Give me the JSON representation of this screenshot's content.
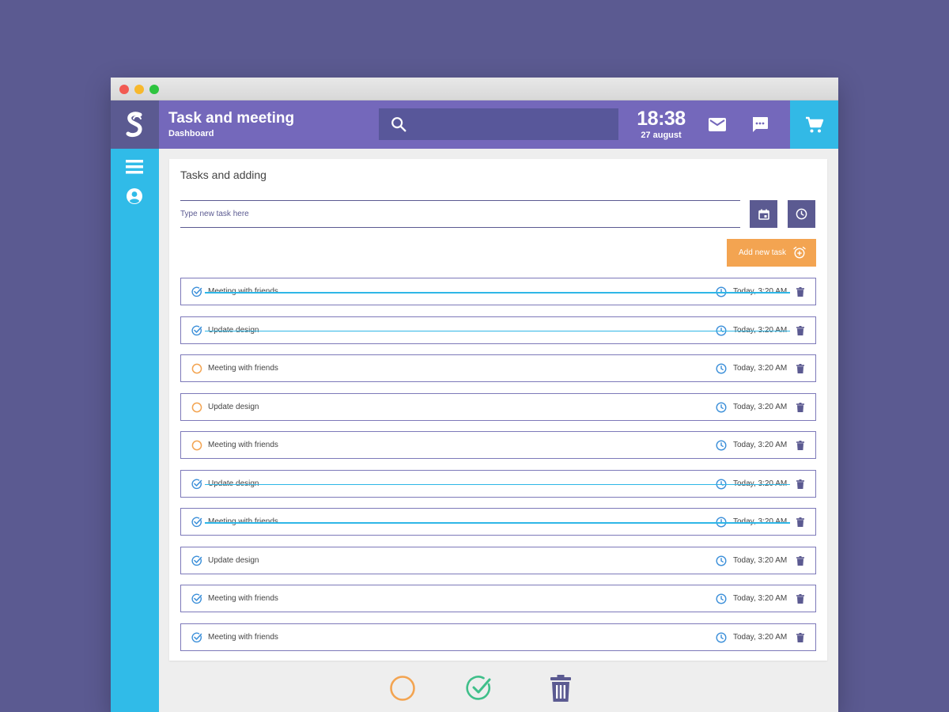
{
  "app": {
    "title": "Task and meeting",
    "subtitle": "Dashboard",
    "logo_letter": "S"
  },
  "header": {
    "time": "18:38",
    "date": "27 august",
    "search_placeholder": ""
  },
  "card": {
    "title": "Tasks and adding",
    "input_placeholder": "Type new task here",
    "add_button_label": "Add new task"
  },
  "tasks": [
    {
      "label": "Meeting with friends",
      "time": "Today, 3:20 AM",
      "state": "done-struck"
    },
    {
      "label": "Update design",
      "time": "Today, 3:20 AM",
      "state": "done-struck"
    },
    {
      "label": "Meeting with friends",
      "time": "Today, 3:20 AM",
      "state": "pending"
    },
    {
      "label": "Update design",
      "time": "Today, 3:20 AM",
      "state": "pending"
    },
    {
      "label": "Meeting with friends",
      "time": "Today, 3:20 AM",
      "state": "pending"
    },
    {
      "label": "Update design",
      "time": "Today, 3:20 AM",
      "state": "done-struck"
    },
    {
      "label": "Meeting with friends",
      "time": "Today, 3:20 AM",
      "state": "done-struck"
    },
    {
      "label": "Update design",
      "time": "Today, 3:20 AM",
      "state": "done"
    },
    {
      "label": "Meeting with friends",
      "time": "Today, 3:20 AM",
      "state": "done"
    },
    {
      "label": "Meeting with friends",
      "time": "Today, 3:20 AM",
      "state": "done"
    }
  ],
  "colors": {
    "background": "#5b5a91",
    "header": "#7468bb",
    "sidebar": "#30bbe8",
    "accent_orange": "#f3a451",
    "accent_green": "#3fbf8a",
    "icon_blue": "#3b8fd9",
    "icon_purple": "#5b5a91"
  },
  "icons": {
    "logo": "s-logo-icon",
    "search": "search-icon",
    "mail": "mail-icon",
    "chat": "chat-icon",
    "cart": "cart-icon",
    "menu": "menu-icon",
    "account": "account-icon",
    "calendar": "calendar-icon",
    "clock": "clock-icon",
    "alarm_add": "alarm-add-icon",
    "check_circle": "check-circle-icon",
    "pending_circle": "pending-circle-icon",
    "delete": "trash-icon"
  }
}
